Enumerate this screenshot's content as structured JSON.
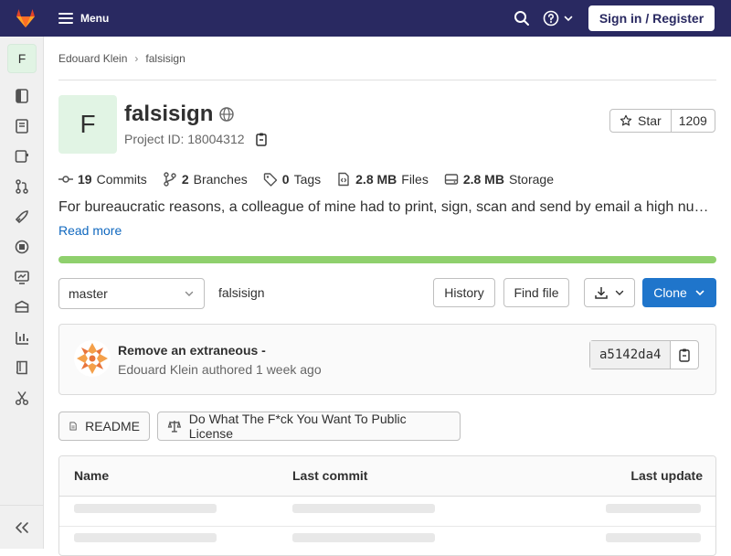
{
  "navbar": {
    "menu_label": "Menu",
    "signin_label": "Sign in / Register",
    "colors": {
      "background": "#292961",
      "accent": "#fc6d26"
    }
  },
  "sidebar": {
    "project_initial": "F",
    "items": [
      {
        "icon": "project-overview-icon"
      },
      {
        "icon": "repository-icon"
      },
      {
        "icon": "issues-icon"
      },
      {
        "icon": "merge-requests-icon"
      },
      {
        "icon": "ci-cd-rocket-icon"
      },
      {
        "icon": "deployments-icon"
      },
      {
        "icon": "monitor-icon"
      },
      {
        "icon": "packages-icon"
      },
      {
        "icon": "analytics-icon"
      },
      {
        "icon": "wiki-icon"
      },
      {
        "icon": "snippets-scissors-icon"
      }
    ],
    "collapse_icon": "collapse-sidebar-icon"
  },
  "breadcrumb": {
    "items": [
      "Edouard Klein",
      "falsisign"
    ]
  },
  "project": {
    "initial": "F",
    "name": "falsisign",
    "visibility_icon": "globe-icon",
    "id_text": "Project ID: 18004312",
    "star_label": "Star",
    "star_count": "1209",
    "description": "For bureaucratic reasons, a colleague of mine had to print, sign, scan and send by email a high number of pages.",
    "read_more": "Read more",
    "language_color": "#8fd06d"
  },
  "stats": {
    "commits_count": "19",
    "commits_label": "Commits",
    "branches_count": "2",
    "branches_label": "Branches",
    "tags_count": "0",
    "tags_label": "Tags",
    "files_size": "2.8 MB",
    "files_label": "Files",
    "storage_size": "2.8 MB",
    "storage_label": "Storage"
  },
  "controls": {
    "branch": "master",
    "path": "falsisign",
    "history": "History",
    "find_file": "Find file",
    "clone": "Clone"
  },
  "commit": {
    "title": "Remove an extraneous -",
    "author": "Edouard Klein",
    "authored": "authored",
    "time": "1 week ago",
    "sha": "a5142da4"
  },
  "files": {
    "readme": "README",
    "license": "Do What The F*ck You Want To Public License"
  },
  "tree": {
    "col_name": "Name",
    "col_commit": "Last commit",
    "col_update": "Last update"
  }
}
